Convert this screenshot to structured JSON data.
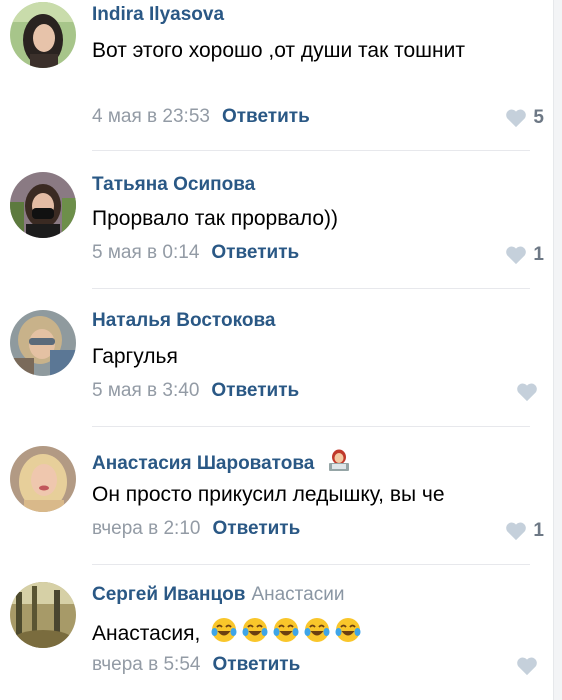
{
  "comments": [
    {
      "author": "Indira Ilyasova",
      "text": "Вот этого хорошо ,от души так тошнит",
      "date": "4 мая в 23:53",
      "reply_label": "Ответить",
      "likes": "5",
      "avatar": "avatar-woman-dark-hair"
    },
    {
      "author": "Татьяна Осипова",
      "text": "Прорвало так прорвало))",
      "date": "5 мая в 0:14",
      "reply_label": "Ответить",
      "likes": "1",
      "avatar": "avatar-woman-mask"
    },
    {
      "author": "Наталья Востокова",
      "text": "Гаргулья",
      "date": "5 мая в 3:40",
      "reply_label": "Ответить",
      "likes": "",
      "avatar": "avatar-woman-sunglasses"
    },
    {
      "author": "Анастасия Шароватова",
      "author_emoji": "woman-technologist-emoji",
      "text": "Он просто прикусил ледышку, вы че",
      "date": "вчера в 2:10",
      "reply_label": "Ответить",
      "likes": "1",
      "avatar": "avatar-woman-blonde"
    },
    {
      "author": "Сергей Иванцов",
      "reply_to": "Анастасии",
      "text": "Анастасия,",
      "text_emoji": "face-with-tears-of-joy-emoji",
      "text_emoji_count": 5,
      "date": "вчера в 5:54",
      "reply_label": "Ответить",
      "likes": "",
      "avatar": "avatar-forest"
    }
  ],
  "colors": {
    "link": "#2a5885",
    "meta": "#939ba5",
    "heart": "#c5d0db",
    "divider": "#e7e8ec"
  }
}
